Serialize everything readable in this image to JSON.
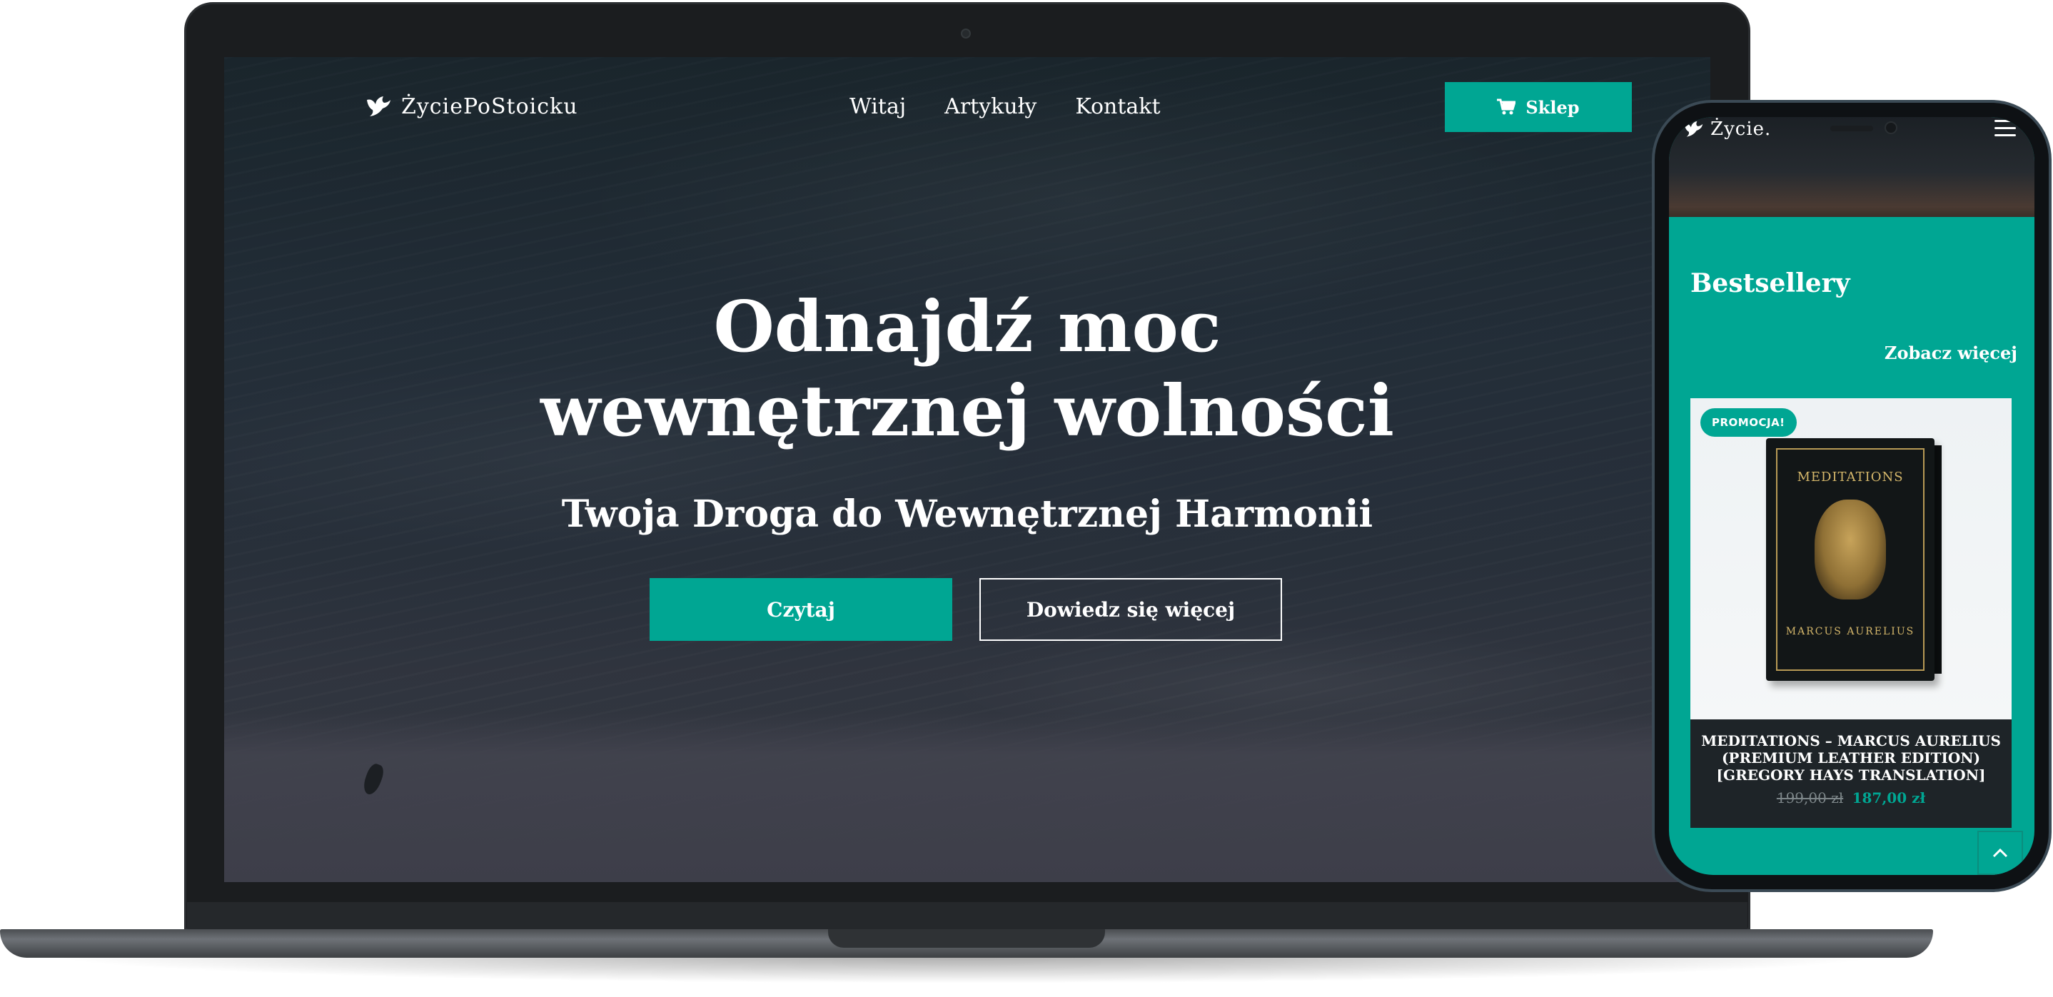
{
  "desktop": {
    "brand": "ŻyciePoStoicku",
    "nav": [
      "Witaj",
      "Artykuły",
      "Kontakt"
    ],
    "shop_label": "Sklep",
    "hero_title": "Odnajdź moc wewnętrznej wolności",
    "hero_subtitle": "Twoja Droga do Wewnętrznej Harmonii",
    "primary_button": "Czytaj",
    "secondary_button": "Dowiedz się więcej"
  },
  "mobile": {
    "brand": "Życie.",
    "section_title": "Bestsellery",
    "see_more": "Zobacz więcej",
    "product": {
      "badge": "PROMOCJA!",
      "cover_title": "MEDITATIONS",
      "cover_author": "MARCUS AURELIUS",
      "name": "MEDITATIONS – MARCUS AURELIUS (PREMIUM LEATHER EDITION) [GREGORY HAYS TRANSLATION]",
      "old_price": "199,00 zł",
      "new_price": "187,00 zł"
    }
  },
  "icons": {
    "logo": "bird-icon",
    "cart": "cart-icon",
    "menu": "hamburger-icon",
    "scroll_top": "chevron-up-icon"
  },
  "colors": {
    "accent": "#00a693",
    "dark_card": "#1e2428",
    "laptop_frame": "#1b1d1f"
  }
}
